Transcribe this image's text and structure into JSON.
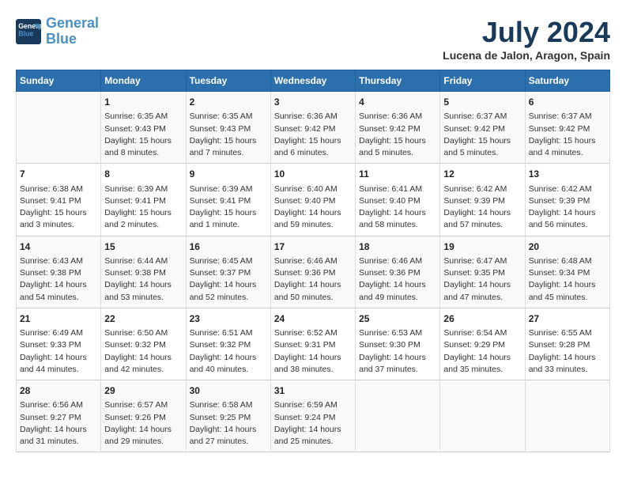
{
  "header": {
    "logo_line1": "General",
    "logo_line2": "Blue",
    "month_year": "July 2024",
    "location": "Lucena de Jalon, Aragon, Spain"
  },
  "weekdays": [
    "Sunday",
    "Monday",
    "Tuesday",
    "Wednesday",
    "Thursday",
    "Friday",
    "Saturday"
  ],
  "weeks": [
    [
      {
        "day": "",
        "sunrise": "",
        "sunset": "",
        "daylight": ""
      },
      {
        "day": "1",
        "sunrise": "Sunrise: 6:35 AM",
        "sunset": "Sunset: 9:43 PM",
        "daylight": "Daylight: 15 hours and 8 minutes."
      },
      {
        "day": "2",
        "sunrise": "Sunrise: 6:35 AM",
        "sunset": "Sunset: 9:43 PM",
        "daylight": "Daylight: 15 hours and 7 minutes."
      },
      {
        "day": "3",
        "sunrise": "Sunrise: 6:36 AM",
        "sunset": "Sunset: 9:42 PM",
        "daylight": "Daylight: 15 hours and 6 minutes."
      },
      {
        "day": "4",
        "sunrise": "Sunrise: 6:36 AM",
        "sunset": "Sunset: 9:42 PM",
        "daylight": "Daylight: 15 hours and 5 minutes."
      },
      {
        "day": "5",
        "sunrise": "Sunrise: 6:37 AM",
        "sunset": "Sunset: 9:42 PM",
        "daylight": "Daylight: 15 hours and 5 minutes."
      },
      {
        "day": "6",
        "sunrise": "Sunrise: 6:37 AM",
        "sunset": "Sunset: 9:42 PM",
        "daylight": "Daylight: 15 hours and 4 minutes."
      }
    ],
    [
      {
        "day": "7",
        "sunrise": "Sunrise: 6:38 AM",
        "sunset": "Sunset: 9:41 PM",
        "daylight": "Daylight: 15 hours and 3 minutes."
      },
      {
        "day": "8",
        "sunrise": "Sunrise: 6:39 AM",
        "sunset": "Sunset: 9:41 PM",
        "daylight": "Daylight: 15 hours and 2 minutes."
      },
      {
        "day": "9",
        "sunrise": "Sunrise: 6:39 AM",
        "sunset": "Sunset: 9:41 PM",
        "daylight": "Daylight: 15 hours and 1 minute."
      },
      {
        "day": "10",
        "sunrise": "Sunrise: 6:40 AM",
        "sunset": "Sunset: 9:40 PM",
        "daylight": "Daylight: 14 hours and 59 minutes."
      },
      {
        "day": "11",
        "sunrise": "Sunrise: 6:41 AM",
        "sunset": "Sunset: 9:40 PM",
        "daylight": "Daylight: 14 hours and 58 minutes."
      },
      {
        "day": "12",
        "sunrise": "Sunrise: 6:42 AM",
        "sunset": "Sunset: 9:39 PM",
        "daylight": "Daylight: 14 hours and 57 minutes."
      },
      {
        "day": "13",
        "sunrise": "Sunrise: 6:42 AM",
        "sunset": "Sunset: 9:39 PM",
        "daylight": "Daylight: 14 hours and 56 minutes."
      }
    ],
    [
      {
        "day": "14",
        "sunrise": "Sunrise: 6:43 AM",
        "sunset": "Sunset: 9:38 PM",
        "daylight": "Daylight: 14 hours and 54 minutes."
      },
      {
        "day": "15",
        "sunrise": "Sunrise: 6:44 AM",
        "sunset": "Sunset: 9:38 PM",
        "daylight": "Daylight: 14 hours and 53 minutes."
      },
      {
        "day": "16",
        "sunrise": "Sunrise: 6:45 AM",
        "sunset": "Sunset: 9:37 PM",
        "daylight": "Daylight: 14 hours and 52 minutes."
      },
      {
        "day": "17",
        "sunrise": "Sunrise: 6:46 AM",
        "sunset": "Sunset: 9:36 PM",
        "daylight": "Daylight: 14 hours and 50 minutes."
      },
      {
        "day": "18",
        "sunrise": "Sunrise: 6:46 AM",
        "sunset": "Sunset: 9:36 PM",
        "daylight": "Daylight: 14 hours and 49 minutes."
      },
      {
        "day": "19",
        "sunrise": "Sunrise: 6:47 AM",
        "sunset": "Sunset: 9:35 PM",
        "daylight": "Daylight: 14 hours and 47 minutes."
      },
      {
        "day": "20",
        "sunrise": "Sunrise: 6:48 AM",
        "sunset": "Sunset: 9:34 PM",
        "daylight": "Daylight: 14 hours and 45 minutes."
      }
    ],
    [
      {
        "day": "21",
        "sunrise": "Sunrise: 6:49 AM",
        "sunset": "Sunset: 9:33 PM",
        "daylight": "Daylight: 14 hours and 44 minutes."
      },
      {
        "day": "22",
        "sunrise": "Sunrise: 6:50 AM",
        "sunset": "Sunset: 9:32 PM",
        "daylight": "Daylight: 14 hours and 42 minutes."
      },
      {
        "day": "23",
        "sunrise": "Sunrise: 6:51 AM",
        "sunset": "Sunset: 9:32 PM",
        "daylight": "Daylight: 14 hours and 40 minutes."
      },
      {
        "day": "24",
        "sunrise": "Sunrise: 6:52 AM",
        "sunset": "Sunset: 9:31 PM",
        "daylight": "Daylight: 14 hours and 38 minutes."
      },
      {
        "day": "25",
        "sunrise": "Sunrise: 6:53 AM",
        "sunset": "Sunset: 9:30 PM",
        "daylight": "Daylight: 14 hours and 37 minutes."
      },
      {
        "day": "26",
        "sunrise": "Sunrise: 6:54 AM",
        "sunset": "Sunset: 9:29 PM",
        "daylight": "Daylight: 14 hours and 35 minutes."
      },
      {
        "day": "27",
        "sunrise": "Sunrise: 6:55 AM",
        "sunset": "Sunset: 9:28 PM",
        "daylight": "Daylight: 14 hours and 33 minutes."
      }
    ],
    [
      {
        "day": "28",
        "sunrise": "Sunrise: 6:56 AM",
        "sunset": "Sunset: 9:27 PM",
        "daylight": "Daylight: 14 hours and 31 minutes."
      },
      {
        "day": "29",
        "sunrise": "Sunrise: 6:57 AM",
        "sunset": "Sunset: 9:26 PM",
        "daylight": "Daylight: 14 hours and 29 minutes."
      },
      {
        "day": "30",
        "sunrise": "Sunrise: 6:58 AM",
        "sunset": "Sunset: 9:25 PM",
        "daylight": "Daylight: 14 hours and 27 minutes."
      },
      {
        "day": "31",
        "sunrise": "Sunrise: 6:59 AM",
        "sunset": "Sunset: 9:24 PM",
        "daylight": "Daylight: 14 hours and 25 minutes."
      },
      {
        "day": "",
        "sunrise": "",
        "sunset": "",
        "daylight": ""
      },
      {
        "day": "",
        "sunrise": "",
        "sunset": "",
        "daylight": ""
      },
      {
        "day": "",
        "sunrise": "",
        "sunset": "",
        "daylight": ""
      }
    ]
  ]
}
